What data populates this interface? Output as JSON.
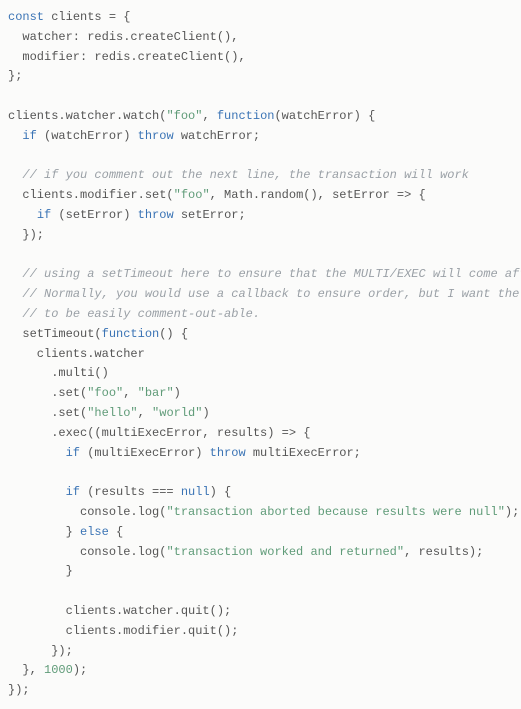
{
  "code": {
    "l01a": "const",
    "l01b": " clients = {",
    "l02": "  watcher: redis.createClient(),",
    "l03": "  modifier: redis.createClient(),",
    "l04": "};",
    "l05": "",
    "l06a": "clients.watcher.watch(",
    "l06b": "\"foo\"",
    "l06c": ", ",
    "l06d": "function",
    "l06e": "(watchError) {",
    "l07a": "  ",
    "l07b": "if",
    "l07c": " (watchError) ",
    "l07d": "throw",
    "l07e": " watchError;",
    "l08": "",
    "l09a": "  ",
    "l09b": "// if you comment out the next line, the transaction will work",
    "l10a": "  clients.modifier.set(",
    "l10b": "\"foo\"",
    "l10c": ", Math.random(), setError => {",
    "l11a": "    ",
    "l11b": "if",
    "l11c": " (setError) ",
    "l11d": "throw",
    "l11e": " setError;",
    "l12": "  });",
    "l13": "",
    "l14a": "  ",
    "l14b": "// using a setTimeout here to ensure that the MULTI/EXEC will come after the SET.",
    "l15a": "  ",
    "l15b": "// Normally, you would use a callback to ensure order, but I want the above SET command",
    "l16a": "  ",
    "l16b": "// to be easily comment-out-able.",
    "l17a": "  setTimeout(",
    "l17b": "function",
    "l17c": "() {",
    "l18": "    clients.watcher",
    "l19": "      .multi()",
    "l20a": "      .set(",
    "l20b": "\"foo\"",
    "l20c": ", ",
    "l20d": "\"bar\"",
    "l20e": ")",
    "l21a": "      .set(",
    "l21b": "\"hello\"",
    "l21c": ", ",
    "l21d": "\"world\"",
    "l21e": ")",
    "l22": "      .exec((multiExecError, results) => {",
    "l23a": "        ",
    "l23b": "if",
    "l23c": " (multiExecError) ",
    "l23d": "throw",
    "l23e": " multiExecError;",
    "l24": "",
    "l25a": "        ",
    "l25b": "if",
    "l25c": " (results === ",
    "l25d": "null",
    "l25e": ") {",
    "l26a": "          console.log(",
    "l26b": "\"transaction aborted because results were null\"",
    "l26c": ");",
    "l27a": "        } ",
    "l27b": "else",
    "l27c": " {",
    "l28a": "          console.log(",
    "l28b": "\"transaction worked and returned\"",
    "l28c": ", results);",
    "l29": "        }",
    "l30": "",
    "l31": "        clients.watcher.quit();",
    "l32": "        clients.modifier.quit();",
    "l33": "      });",
    "l34a": "  }, ",
    "l34b": "1000",
    "l34c": ");",
    "l35": "});"
  }
}
